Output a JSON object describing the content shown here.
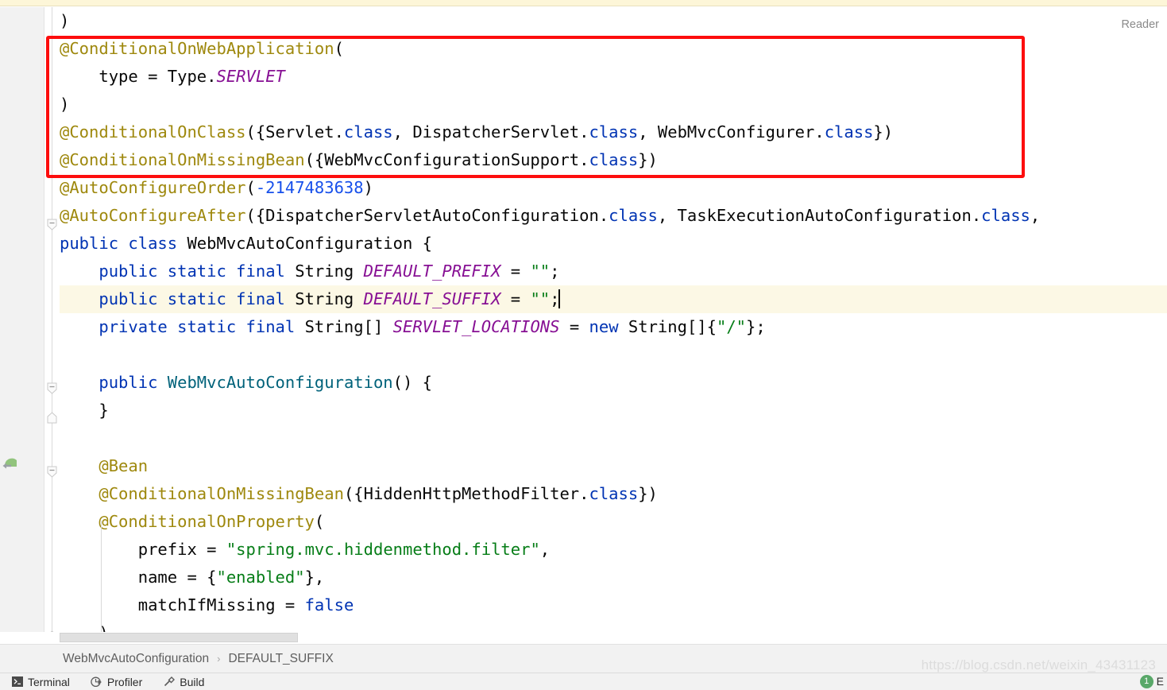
{
  "window": {
    "reader_label": "Reader",
    "watermark": "https://blog.csdn.net/weixin_43431123"
  },
  "editor": {
    "language": "java",
    "file_class": "WebMvcAutoConfiguration",
    "highlighted_line_index": 10,
    "annotation_box": {
      "color": "#fd0d0d",
      "covers_lines": "@ConditionalOnWebApplication ... @ConditionalOnMissingBean"
    },
    "colors": {
      "keyword": "#0033b3",
      "annotation": "#9e880d",
      "string": "#067d17",
      "number": "#1750eb",
      "constant": "#871094",
      "method": "#00627a",
      "text": "#080808",
      "caret_line_bg": "#fcf8e5",
      "gutter_bg": "#f2f2f2"
    },
    "lines": [
      {
        "n": 1,
        "indent": 0,
        "tokens": [
          {
            "t": ")",
            "c": "plain"
          }
        ]
      },
      {
        "n": 2,
        "indent": 0,
        "tokens": [
          {
            "t": "@ConditionalOnWebApplication",
            "c": "anno"
          },
          {
            "t": "(",
            "c": "plain"
          }
        ]
      },
      {
        "n": 3,
        "indent": 1,
        "tokens": [
          {
            "t": "type = Type.",
            "c": "plain"
          },
          {
            "t": "SERVLET",
            "c": "const"
          }
        ]
      },
      {
        "n": 4,
        "indent": 0,
        "tokens": [
          {
            "t": ")",
            "c": "plain"
          }
        ]
      },
      {
        "n": 5,
        "indent": 0,
        "tokens": [
          {
            "t": "@ConditionalOnClass",
            "c": "anno"
          },
          {
            "t": "({Servlet.",
            "c": "plain"
          },
          {
            "t": "class",
            "c": "cls"
          },
          {
            "t": ", DispatcherServlet.",
            "c": "plain"
          },
          {
            "t": "class",
            "c": "cls"
          },
          {
            "t": ", WebMvcConfigurer.",
            "c": "plain"
          },
          {
            "t": "class",
            "c": "cls"
          },
          {
            "t": "})",
            "c": "plain"
          }
        ]
      },
      {
        "n": 6,
        "indent": 0,
        "tokens": [
          {
            "t": "@ConditionalOnMissingBean",
            "c": "anno"
          },
          {
            "t": "({WebMvcConfigurationSupport.",
            "c": "plain"
          },
          {
            "t": "class",
            "c": "cls"
          },
          {
            "t": "})",
            "c": "plain"
          }
        ]
      },
      {
        "n": 7,
        "indent": 0,
        "tokens": [
          {
            "t": "@AutoConfigureOrder",
            "c": "anno"
          },
          {
            "t": "(",
            "c": "plain"
          },
          {
            "t": "-2147483638",
            "c": "num"
          },
          {
            "t": ")",
            "c": "plain"
          }
        ]
      },
      {
        "n": 8,
        "indent": 0,
        "tokens": [
          {
            "t": "@AutoConfigureAfter",
            "c": "anno"
          },
          {
            "t": "({DispatcherServletAutoConfiguration.",
            "c": "plain"
          },
          {
            "t": "class",
            "c": "cls"
          },
          {
            "t": ", TaskExecutionAutoConfiguration.",
            "c": "plain"
          },
          {
            "t": "class",
            "c": "cls"
          },
          {
            "t": ",",
            "c": "plain"
          }
        ]
      },
      {
        "n": 9,
        "indent": 0,
        "tokens": [
          {
            "t": "public class ",
            "c": "kw"
          },
          {
            "t": "WebMvcAutoConfiguration {",
            "c": "plain"
          }
        ]
      },
      {
        "n": 10,
        "indent": 1,
        "tokens": [
          {
            "t": "public static final ",
            "c": "kw"
          },
          {
            "t": "String ",
            "c": "plain"
          },
          {
            "t": "DEFAULT_PREFIX",
            "c": "const"
          },
          {
            "t": " = ",
            "c": "plain"
          },
          {
            "t": "\"\"",
            "c": "str"
          },
          {
            "t": ";",
            "c": "plain"
          }
        ]
      },
      {
        "n": 11,
        "indent": 1,
        "tokens": [
          {
            "t": "public static final ",
            "c": "kw"
          },
          {
            "t": "String ",
            "c": "plain"
          },
          {
            "t": "DEFAULT_SUFFIX",
            "c": "const"
          },
          {
            "t": " = ",
            "c": "plain"
          },
          {
            "t": "\"\"",
            "c": "str"
          },
          {
            "t": ";",
            "c": "plain"
          }
        ]
      },
      {
        "n": 12,
        "indent": 1,
        "tokens": [
          {
            "t": "private static final ",
            "c": "kw"
          },
          {
            "t": "String[] ",
            "c": "plain"
          },
          {
            "t": "SERVLET_LOCATIONS",
            "c": "const"
          },
          {
            "t": " = ",
            "c": "plain"
          },
          {
            "t": "new ",
            "c": "kw"
          },
          {
            "t": "String[]{",
            "c": "plain"
          },
          {
            "t": "\"/\"",
            "c": "str"
          },
          {
            "t": "};",
            "c": "plain"
          }
        ]
      },
      {
        "n": 13,
        "indent": 0,
        "tokens": []
      },
      {
        "n": 14,
        "indent": 1,
        "tokens": [
          {
            "t": "public ",
            "c": "kw"
          },
          {
            "t": "WebMvcAutoConfiguration",
            "c": "meth"
          },
          {
            "t": "() {",
            "c": "plain"
          }
        ]
      },
      {
        "n": 15,
        "indent": 1,
        "tokens": [
          {
            "t": "}",
            "c": "plain"
          }
        ]
      },
      {
        "n": 16,
        "indent": 0,
        "tokens": []
      },
      {
        "n": 17,
        "indent": 1,
        "tokens": [
          {
            "t": "@Bean",
            "c": "anno"
          }
        ]
      },
      {
        "n": 18,
        "indent": 1,
        "tokens": [
          {
            "t": "@ConditionalOnMissingBean",
            "c": "anno"
          },
          {
            "t": "({HiddenHttpMethodFilter.",
            "c": "plain"
          },
          {
            "t": "class",
            "c": "cls"
          },
          {
            "t": "})",
            "c": "plain"
          }
        ]
      },
      {
        "n": 19,
        "indent": 1,
        "tokens": [
          {
            "t": "@ConditionalOnProperty",
            "c": "anno"
          },
          {
            "t": "(",
            "c": "plain"
          }
        ]
      },
      {
        "n": 20,
        "indent": 2,
        "tokens": [
          {
            "t": "prefix = ",
            "c": "plain"
          },
          {
            "t": "\"spring.mvc.hiddenmethod.filter\"",
            "c": "str"
          },
          {
            "t": ",",
            "c": "plain"
          }
        ]
      },
      {
        "n": 21,
        "indent": 2,
        "tokens": [
          {
            "t": "name = {",
            "c": "plain"
          },
          {
            "t": "\"enabled\"",
            "c": "str"
          },
          {
            "t": "},",
            "c": "plain"
          }
        ]
      },
      {
        "n": 22,
        "indent": 2,
        "tokens": [
          {
            "t": "matchIfMissing = ",
            "c": "plain"
          },
          {
            "t": "false",
            "c": "kw"
          }
        ]
      },
      {
        "n": 23,
        "indent": 1,
        "tokens": [
          {
            "t": ")",
            "c": "plain"
          }
        ]
      }
    ]
  },
  "breadcrumb": {
    "items": [
      "WebMvcAutoConfiguration",
      "DEFAULT_SUFFIX"
    ],
    "separator": "›"
  },
  "toolbar": {
    "items": [
      {
        "label": "Terminal",
        "icon": "terminal-icon"
      },
      {
        "label": "Profiler",
        "icon": "profiler-icon"
      },
      {
        "label": "Build",
        "icon": "hammer-icon"
      }
    ],
    "right_badge_count": "1",
    "right_label": "E"
  }
}
